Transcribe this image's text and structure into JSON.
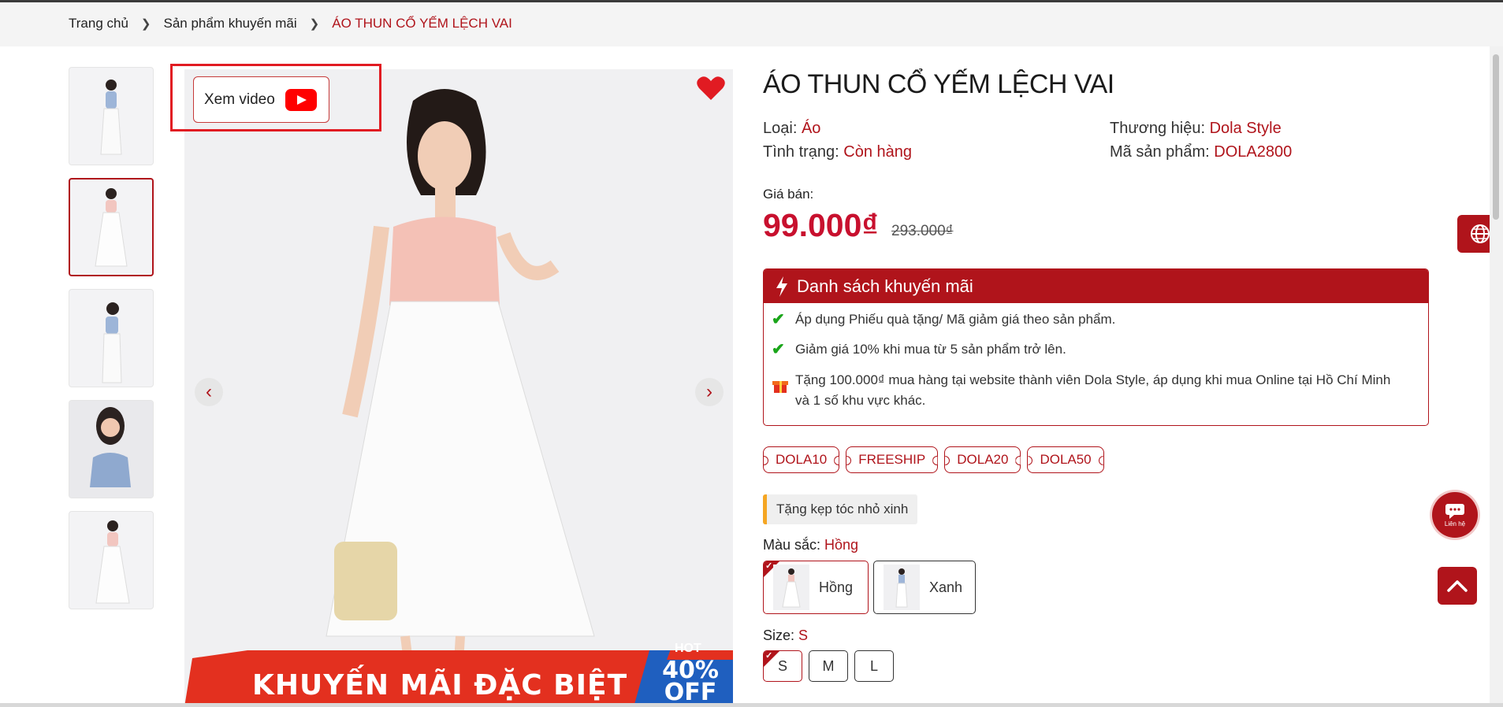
{
  "breadcrumb": {
    "items": [
      "Trang chủ",
      "Sản phẩm khuyến mãi",
      "ÁO THUN CỔ YẾM LỆCH VAI"
    ]
  },
  "gallery": {
    "video_label": "Xem video",
    "banner_text": "KHUYẾN MÃI ĐẶC BIỆT",
    "banner_hot": "HOT",
    "banner_off_1": "40%",
    "banner_off_2": "OFF",
    "thumbnail_count": 5,
    "active_thumbnail": 2
  },
  "product": {
    "title": "ÁO THUN CỔ YẾM LỆCH VAI",
    "type_label": "Loại: ",
    "type_value": "Áo",
    "brand_label": "Thương hiệu: ",
    "brand_value": "Dola Style",
    "status_label": "Tình trạng: ",
    "status_value": "Còn hàng",
    "sku_label": "Mã sản phẩm: ",
    "sku_value": "DOLA2800",
    "price_label": "Giá bán:",
    "price": "99.000₫",
    "old_price": "293.000₫"
  },
  "promotions": {
    "title": "Danh sách khuyến mãi",
    "items": [
      "Áp dụng Phiếu quà tặng/ Mã giảm giá theo sản phẩm.",
      "Giảm giá 10% khi mua từ 5 sản phẩm trở lên.",
      "Tặng 100.000₫ mua hàng tại website thành viên Dola Style, áp dụng khi mua Online tại Hồ Chí Minh",
      "và 1 số khu vực khác."
    ]
  },
  "coupons": [
    "DOLA10",
    "FREESHIP",
    "DOLA20",
    "DOLA50"
  ],
  "gift": "Tặng kẹp tóc nhỏ xinh",
  "color": {
    "label": "Màu sắc: ",
    "selected": "Hồng",
    "options": [
      "Hồng",
      "Xanh"
    ]
  },
  "size": {
    "label": "Size: ",
    "selected": "S",
    "options": [
      "S",
      "M",
      "L"
    ]
  },
  "floating": {
    "chat_label": "Liên hệ"
  },
  "colors": {
    "brand": "#b0141b",
    "price": "#c8102e",
    "check": "#1aa51a",
    "video_highlight": "#e11b22"
  },
  "icons": [
    "chevron-right-icon",
    "youtube-icon",
    "heart-icon",
    "arrow-left-icon",
    "arrow-right-icon",
    "bolt-icon",
    "check-icon",
    "gift-icon",
    "globe-icon",
    "chat-icon",
    "arrow-up-icon"
  ]
}
